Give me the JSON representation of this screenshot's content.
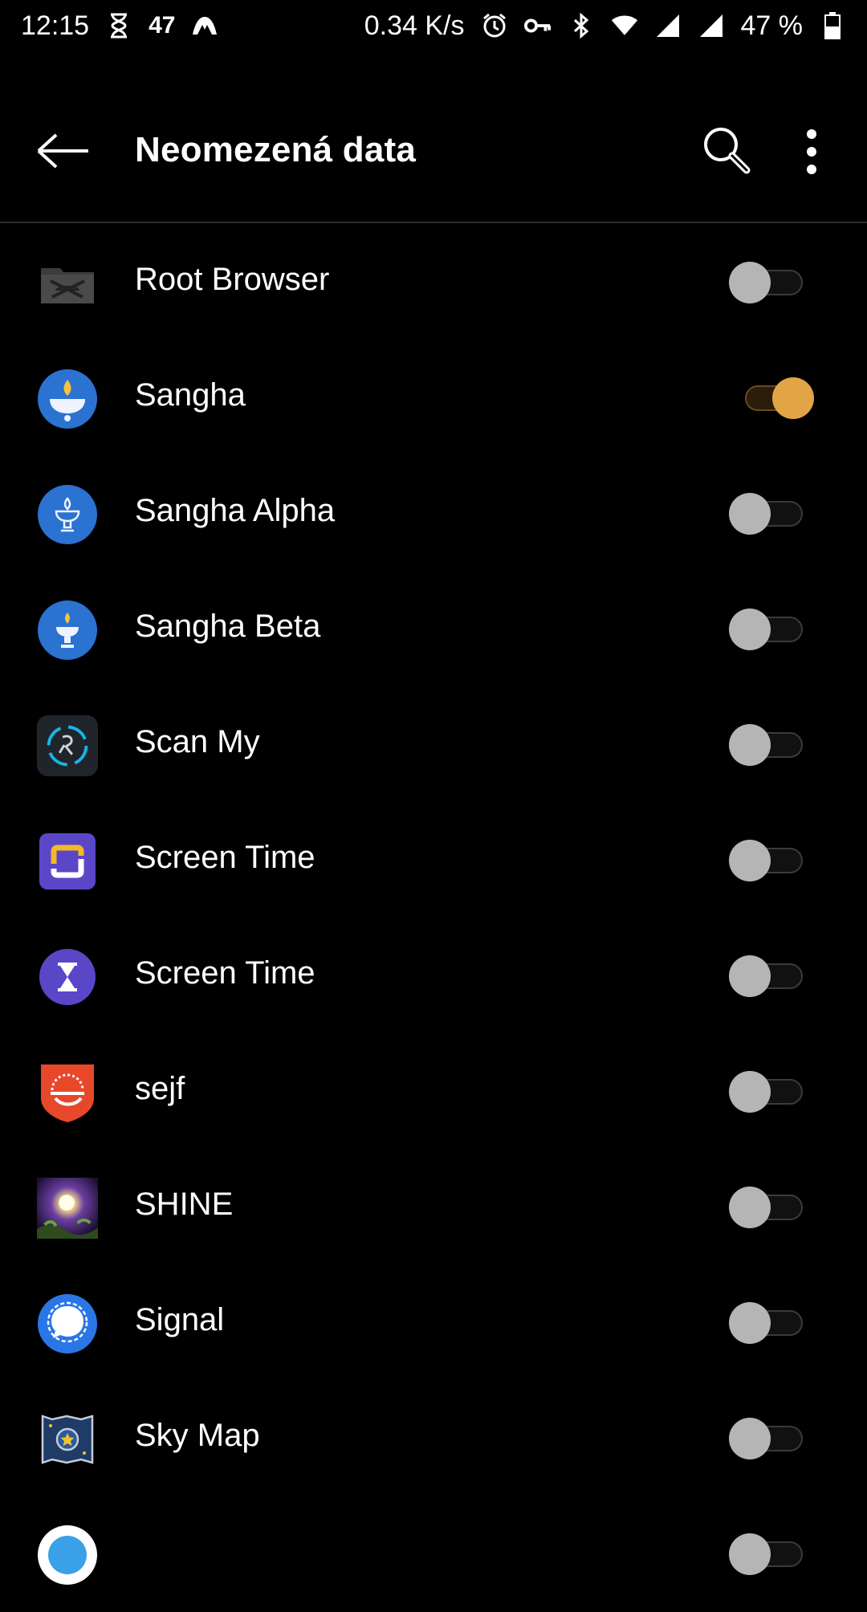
{
  "status_bar": {
    "time": "12:15",
    "notif_count": "47",
    "net_speed": "0.34 K/s",
    "battery": "47 %"
  },
  "app_bar": {
    "title": "Neomezená data"
  },
  "apps": [
    {
      "label": "Root Browser",
      "icon": "root-browser-icon",
      "enabled": false
    },
    {
      "label": "Sangha",
      "icon": "sangha-icon",
      "enabled": true
    },
    {
      "label": "Sangha Alpha",
      "icon": "sangha-alpha-icon",
      "enabled": false
    },
    {
      "label": "Sangha Beta",
      "icon": "sangha-beta-icon",
      "enabled": false
    },
    {
      "label": "Scan My",
      "icon": "scan-my-icon",
      "enabled": false
    },
    {
      "label": "Screen Time",
      "icon": "screen-time-icon",
      "enabled": false
    },
    {
      "label": "Screen Time",
      "icon": "screen-time-hourglass-icon",
      "enabled": false
    },
    {
      "label": "sejf",
      "icon": "sejf-icon",
      "enabled": false
    },
    {
      "label": "SHINE",
      "icon": "shine-icon",
      "enabled": false
    },
    {
      "label": "Signal",
      "icon": "signal-icon",
      "enabled": false
    },
    {
      "label": "Sky Map",
      "icon": "sky-map-icon",
      "enabled": false
    }
  ],
  "colors": {
    "accent": "#e1a447",
    "background": "#000000",
    "toggle_off": "#b5b5b5"
  }
}
